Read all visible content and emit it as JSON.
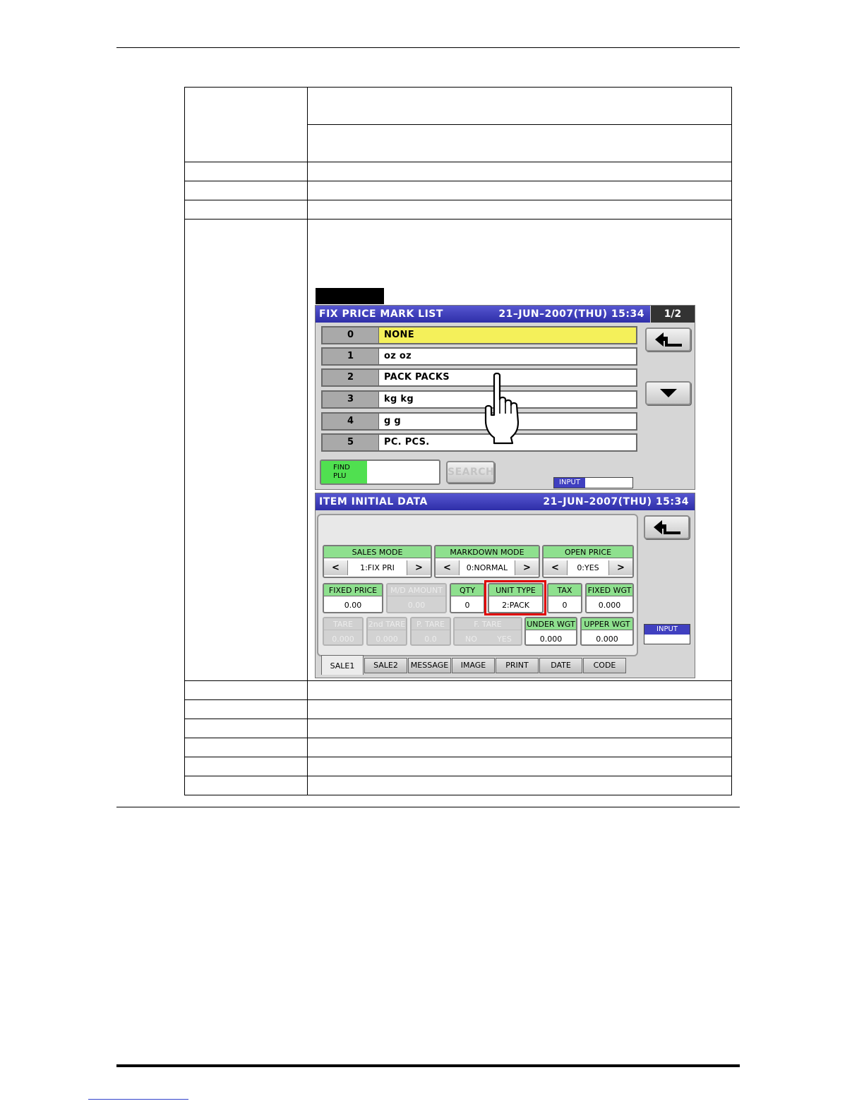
{
  "fix_price_screen": {
    "title": "FIX PRICE MARK LIST",
    "datetime": "21–JUN–2007(THU)  15:34",
    "page": "1/2",
    "rows": [
      {
        "num": "0",
        "name": "NONE"
      },
      {
        "num": "1",
        "name": "oz oz"
      },
      {
        "num": "2",
        "name": "PACK PACKS"
      },
      {
        "num": "3",
        "name": "kg kg"
      },
      {
        "num": "4",
        "name": "g g"
      },
      {
        "num": "5",
        "name": "PC. PCS."
      }
    ],
    "selected_row": 0,
    "find_plu_line1": "FIND",
    "find_plu_line2": "PLU",
    "search_label": "SEARCH",
    "input_label": "INPUT",
    "back_icon": "return-arrow-icon",
    "down_icon": "triangle-down-icon"
  },
  "item_screen": {
    "title": "ITEM INITIAL DATA",
    "datetime": "21–JUN–2007(THU)  15:34",
    "input_label": "INPUT",
    "sales_mode": {
      "label": "SALES MODE",
      "value": "1:FIX PRI"
    },
    "markdown_mode": {
      "label": "MARKDOWN MODE",
      "value": "0:NORMAL"
    },
    "open_price": {
      "label": "OPEN PRICE",
      "value": "0:YES"
    },
    "fixed_price": {
      "label": "FIXED PRICE",
      "value": "0.00"
    },
    "md_amount": {
      "label": "M/D AMOUNT",
      "value": "0.00"
    },
    "qty": {
      "label": "QTY",
      "value": "0"
    },
    "unit_type": {
      "label": "UNIT TYPE",
      "value": "2:PACK"
    },
    "tax": {
      "label": "TAX",
      "value": "0"
    },
    "fixed_wgt": {
      "label": "FIXED WGT",
      "value": "0.000"
    },
    "tare": {
      "label": "TARE",
      "value": "0.000"
    },
    "tare2": {
      "label": "2nd TARE",
      "value": "0.000"
    },
    "p_tare": {
      "label": "P. TARE",
      "value": "0.0"
    },
    "f_tare": {
      "label": "F. TARE",
      "no": "NO",
      "yes": "YES"
    },
    "under_wgt": {
      "label": "UNDER WGT",
      "value": "0.000"
    },
    "upper_wgt": {
      "label": "UPPER WGT",
      "value": "0.000"
    },
    "tabs": [
      "SALE1",
      "SALE2",
      "MESSAGE",
      "IMAGE",
      "PRINT",
      "DATE",
      "CODE"
    ],
    "active_tab": "SALE1",
    "lt": "<",
    "gt": ">"
  },
  "colors": {
    "title_bar": "#3a3ab8",
    "selected_row": "#f4f05a",
    "field_header": "#8ee08e",
    "highlight_box": "#e00000"
  }
}
